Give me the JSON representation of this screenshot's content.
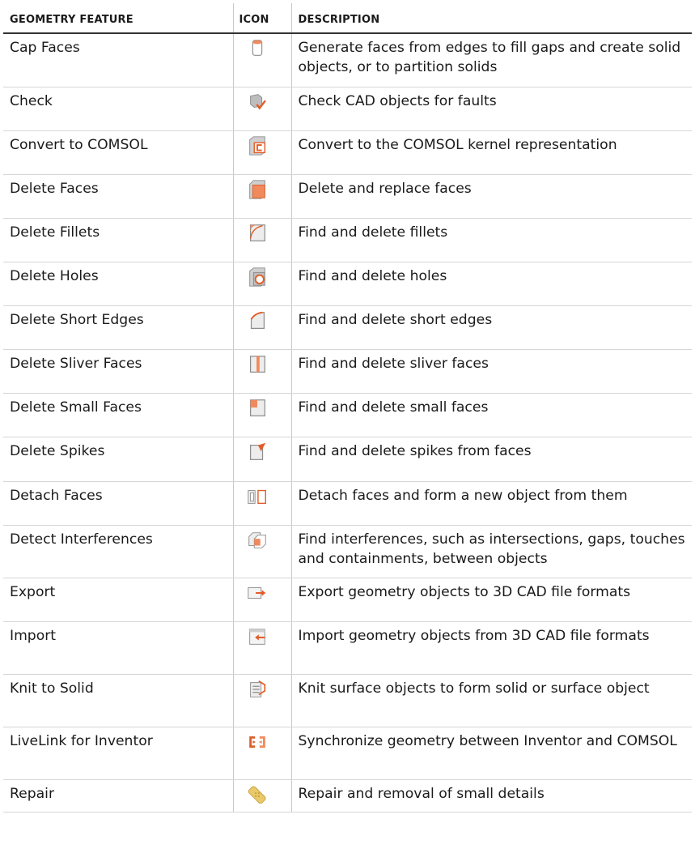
{
  "header": {
    "feature": "GEOMETRY FEATURE",
    "icon": "ICON",
    "description": "DESCRIPTION"
  },
  "rows": [
    {
      "feature": "Cap Faces",
      "icon": "cap-faces-icon",
      "description": "Generate faces from edges to fill gaps and create solid objects, or to partition solids"
    },
    {
      "feature": "Check",
      "icon": "check-icon",
      "description": "Check CAD objects for faults"
    },
    {
      "feature": "Convert to COMSOL",
      "icon": "convert-to-comsol-icon",
      "description": "Convert to the COMSOL kernel representation"
    },
    {
      "feature": "Delete Faces",
      "icon": "delete-faces-icon",
      "description": "Delete and replace faces"
    },
    {
      "feature": "Delete Fillets",
      "icon": "delete-fillets-icon",
      "description": "Find and delete fillets"
    },
    {
      "feature": "Delete Holes",
      "icon": "delete-holes-icon",
      "description": "Find and delete holes"
    },
    {
      "feature": "Delete Short Edges",
      "icon": "delete-short-edges-icon",
      "description": "Find and delete short edges"
    },
    {
      "feature": "Delete Sliver Faces",
      "icon": "delete-sliver-faces-icon",
      "description": "Find and delete sliver faces"
    },
    {
      "feature": "Delete Small Faces",
      "icon": "delete-small-faces-icon",
      "description": "Find and delete small faces"
    },
    {
      "feature": "Delete Spikes",
      "icon": "delete-spikes-icon",
      "description": "Find and delete spikes from faces"
    },
    {
      "feature": "Detach Faces",
      "icon": "detach-faces-icon",
      "description": "Detach faces and form a new object from them"
    },
    {
      "feature": "Detect Interferences",
      "icon": "detect-interferences-icon",
      "description": "Find interferences, such as intersections, gaps, touches and containments, between objects"
    },
    {
      "feature": "Export",
      "icon": "export-icon",
      "description": "Export geometry objects to 3D CAD file formats"
    },
    {
      "feature": "Import",
      "icon": "import-icon",
      "description": "Import geometry objects from 3D CAD file formats"
    },
    {
      "feature": "Knit to Solid",
      "icon": "knit-to-solid-icon",
      "description": "Knit surface objects to form solid or surface object"
    },
    {
      "feature": "LiveLink for Inventor",
      "icon": "livelink-inventor-icon",
      "description": "Synchronize geometry between Inventor and COMSOL"
    },
    {
      "feature": "Repair",
      "icon": "repair-icon",
      "description": "Repair and removal of small details"
    }
  ],
  "colors": {
    "accent": "#f08a5d",
    "accent_dark": "#d9612f",
    "gray": "#b9b9b9"
  }
}
